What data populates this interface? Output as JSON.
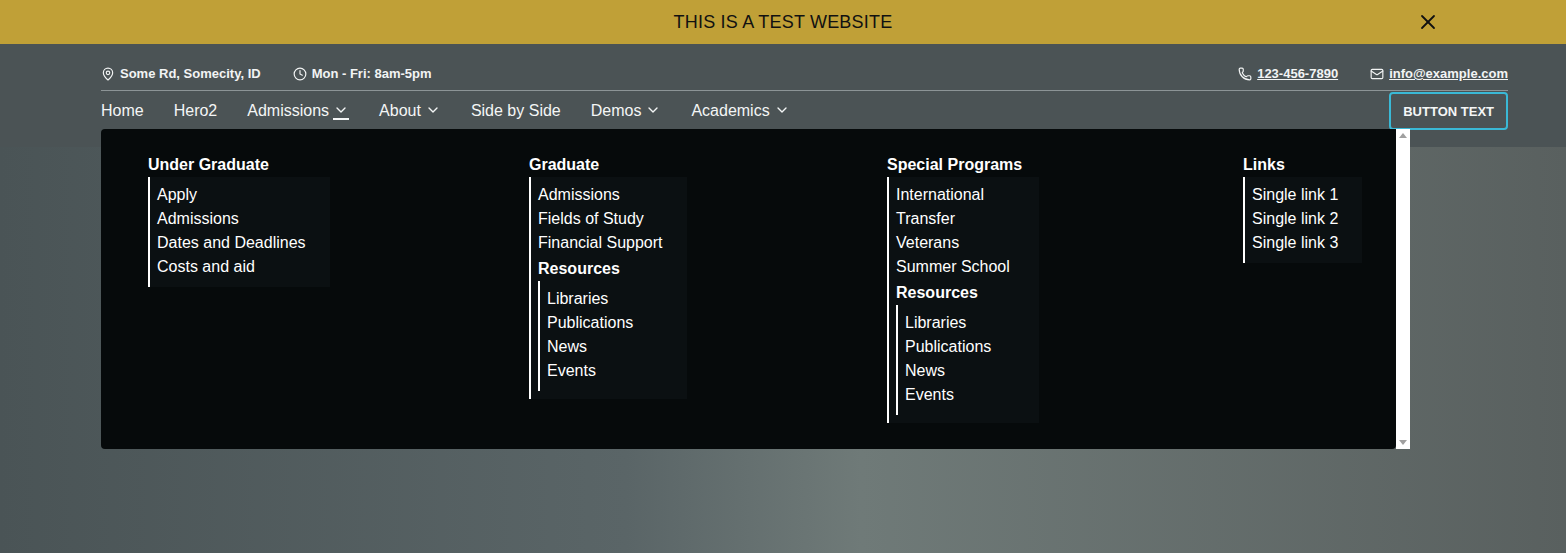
{
  "banner": {
    "text": "THIS IS A TEST WEBSITE"
  },
  "contact": {
    "address": "Some Rd, Somecity, ID",
    "hours": "Mon - Fri: 8am-5pm",
    "phone": "123-456-7890",
    "email": "info@example.com"
  },
  "nav": {
    "items": [
      {
        "label": "Home",
        "dropdown": false,
        "expanded": false
      },
      {
        "label": "Hero2",
        "dropdown": false,
        "expanded": false
      },
      {
        "label": "Admissions",
        "dropdown": true,
        "expanded": true
      },
      {
        "label": "About",
        "dropdown": true,
        "expanded": false
      },
      {
        "label": "Side by Side",
        "dropdown": false,
        "expanded": false
      },
      {
        "label": "Demos",
        "dropdown": true,
        "expanded": false
      },
      {
        "label": "Academics",
        "dropdown": true,
        "expanded": false
      }
    ]
  },
  "cta": {
    "label": "BUTTON TEXT"
  },
  "megaMenu": {
    "columns": [
      {
        "heading": "Under Graduate",
        "links": [
          "Apply",
          "Admissions",
          "Dates and Deadlines",
          "Costs and aid"
        ],
        "subgroups": []
      },
      {
        "heading": "Graduate",
        "links": [
          "Admissions",
          "Fields of Study",
          "Financial Support"
        ],
        "subgroups": [
          {
            "heading": "Resources",
            "links": [
              "Libraries",
              "Publications",
              "News",
              "Events"
            ]
          }
        ]
      },
      {
        "heading": "Special Programs",
        "links": [
          "International",
          "Transfer",
          "Veterans",
          "Summer School"
        ],
        "subgroups": [
          {
            "heading": "Resources",
            "links": [
              "Libraries",
              "Publications",
              "News",
              "Events"
            ]
          }
        ]
      },
      {
        "heading": "Links",
        "links": [
          "Single link 1",
          "Single link 2",
          "Single link 3"
        ],
        "subgroups": []
      }
    ]
  }
}
